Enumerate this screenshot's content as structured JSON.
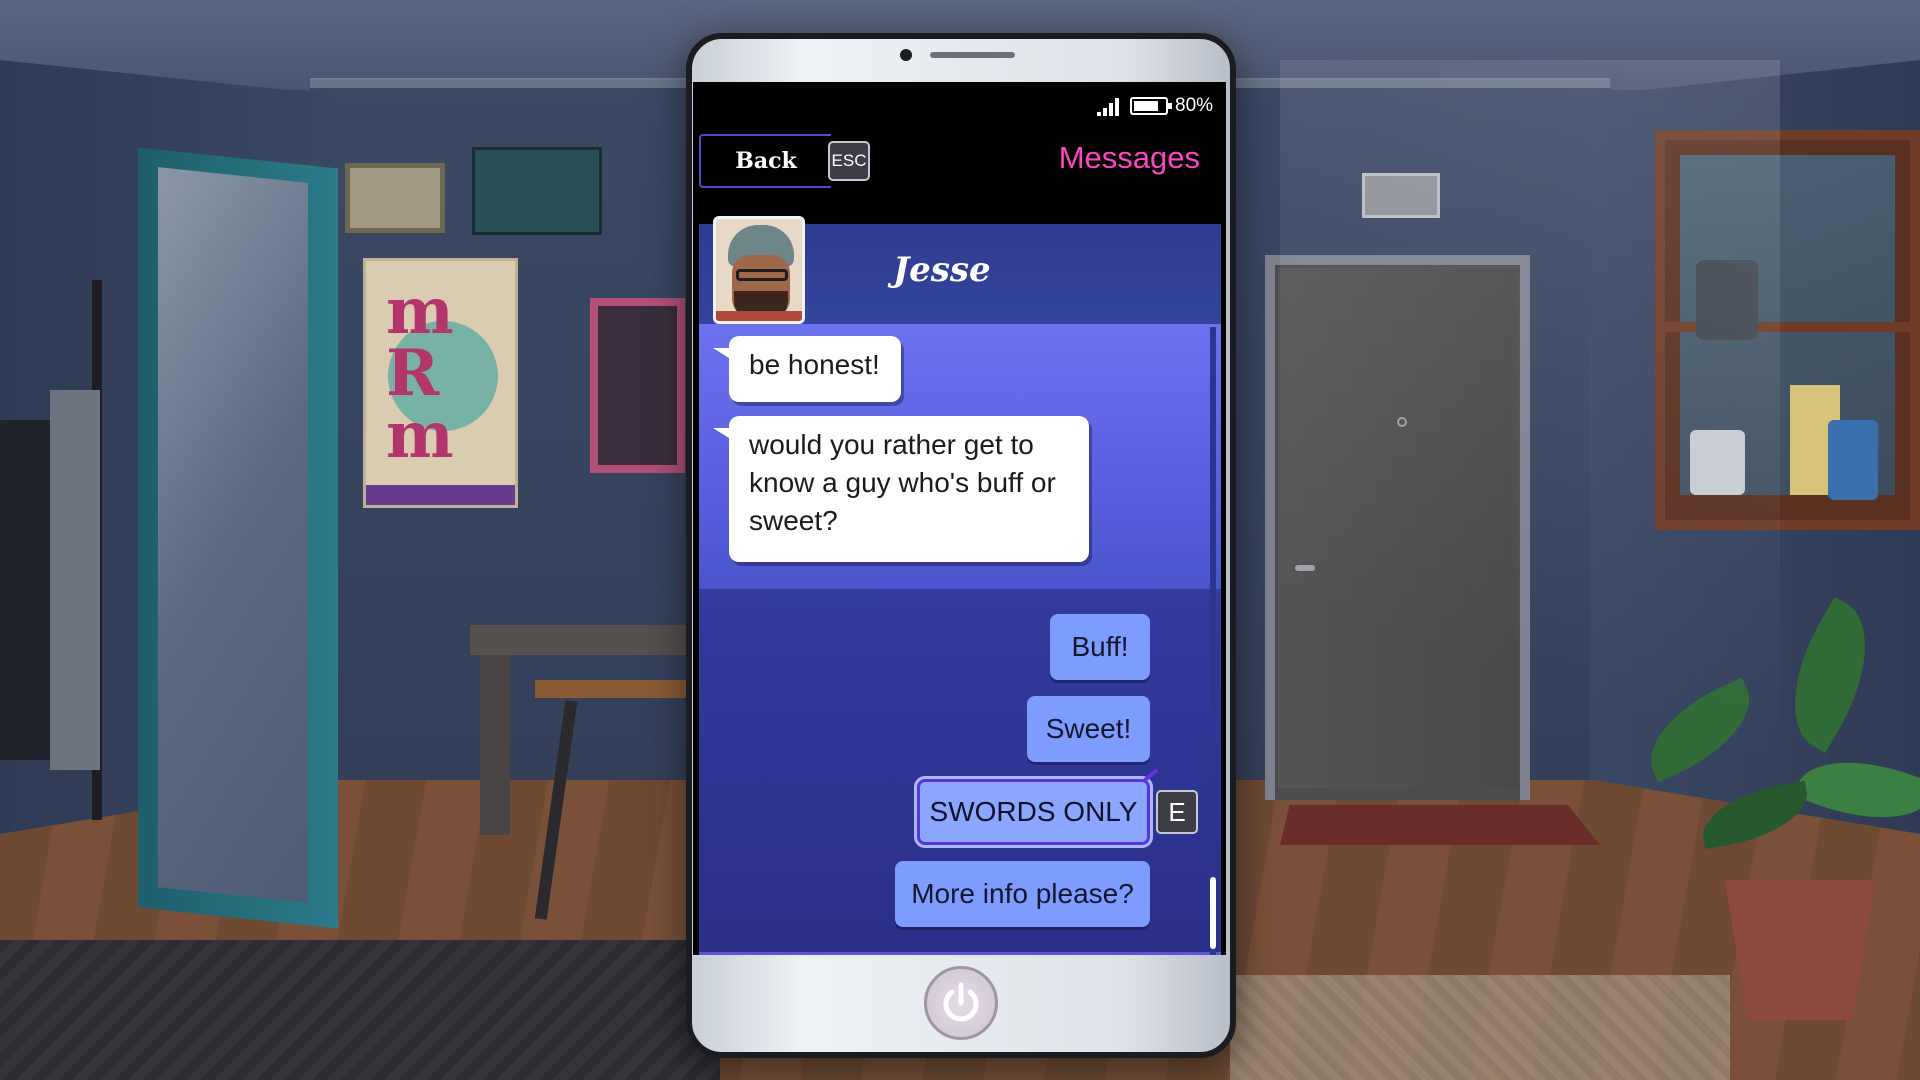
{
  "statusbar": {
    "battery_text": "80%",
    "battery_level": 0.8
  },
  "nav": {
    "back_label": "Back",
    "back_key": "ESC",
    "app_title": "Messages"
  },
  "contact": {
    "name": "Jesse"
  },
  "messages": [
    {
      "from": "Jesse",
      "text": "be honest!"
    },
    {
      "from": "Jesse",
      "text": "would you rather get to know a guy who's buff or sweet?"
    }
  ],
  "replies": [
    {
      "text": "Buff!",
      "selected": false
    },
    {
      "text": "Sweet!",
      "selected": false
    },
    {
      "text": "SWORDS ONLY",
      "selected": true
    },
    {
      "text": "More info please?",
      "selected": false
    }
  ],
  "select_key": "E",
  "colors": {
    "accent_title": "#ff45c0",
    "reply_bubble": "#7d9cff",
    "selected_border": "#5a33e0"
  },
  "icons": [
    "signal-icon",
    "battery-icon",
    "power-icon"
  ]
}
